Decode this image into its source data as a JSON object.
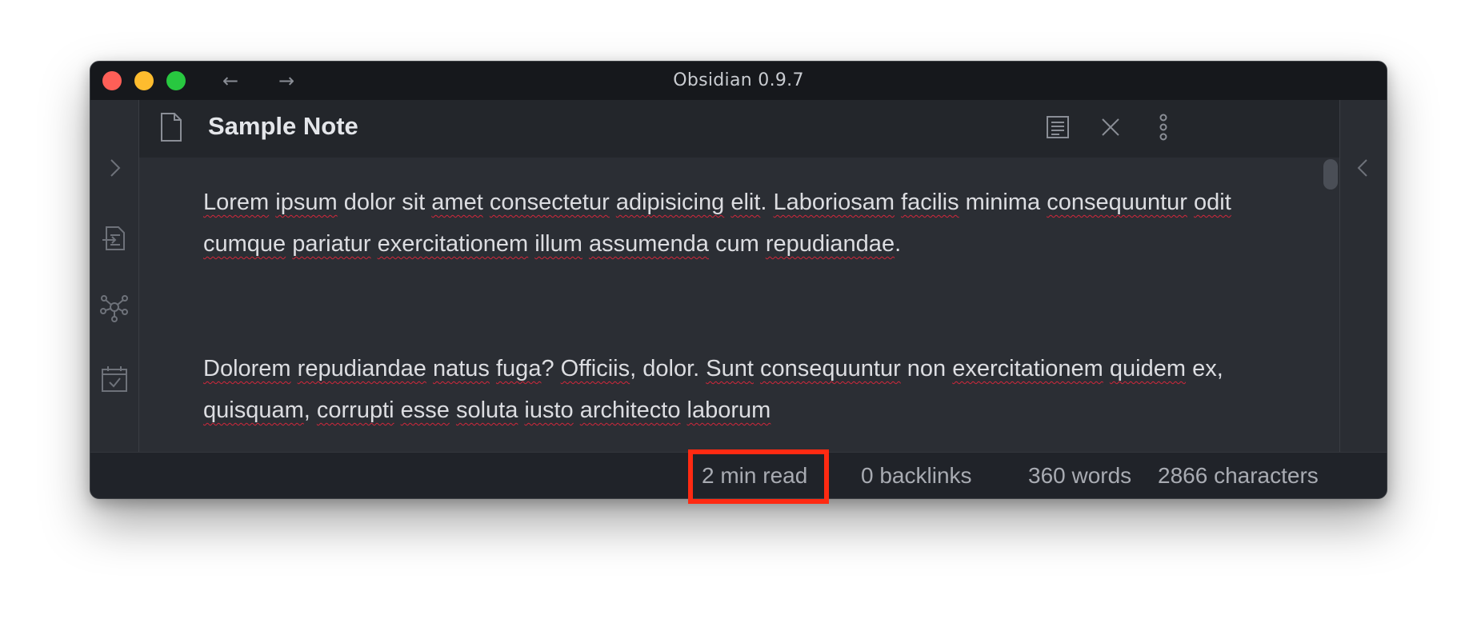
{
  "window": {
    "title": "Obsidian 0.9.7",
    "back_icon": "←",
    "forward_icon": "→"
  },
  "note": {
    "title": "Sample Note",
    "paragraphs": [
      [
        {
          "t": "Lorem",
          "err": true
        },
        {
          "t": " "
        },
        {
          "t": "ipsum",
          "err": true
        },
        {
          "t": " "
        },
        {
          "t": "dolor sit "
        },
        {
          "t": "amet",
          "err": true
        },
        {
          "t": " "
        },
        {
          "t": "consectetur",
          "err": true
        },
        {
          "t": " "
        },
        {
          "t": "adipisicing",
          "err": true
        },
        {
          "t": " "
        },
        {
          "t": "elit",
          "err": true
        },
        {
          "t": ". "
        },
        {
          "t": "Laboriosam",
          "err": true
        },
        {
          "t": " "
        },
        {
          "t": "facilis",
          "err": true
        },
        {
          "t": " minima "
        },
        {
          "t": "consequuntur",
          "err": true
        },
        {
          "t": " "
        },
        {
          "t": "odit",
          "err": true
        },
        {
          "t": " "
        },
        {
          "t": "cumque",
          "err": true
        },
        {
          "t": " "
        },
        {
          "t": "pariatur",
          "err": true
        },
        {
          "t": " "
        },
        {
          "t": "exercitationem",
          "err": true
        },
        {
          "t": " "
        },
        {
          "t": "illum",
          "err": true
        },
        {
          "t": " "
        },
        {
          "t": "assumenda",
          "err": true
        },
        {
          "t": " cum "
        },
        {
          "t": "repudiandae",
          "err": true
        },
        {
          "t": "."
        }
      ],
      [
        {
          "t": "Dolorem",
          "err": true
        },
        {
          "t": " "
        },
        {
          "t": "repudiandae",
          "err": true
        },
        {
          "t": " "
        },
        {
          "t": "natus",
          "err": true
        },
        {
          "t": " "
        },
        {
          "t": "fuga",
          "err": true
        },
        {
          "t": "? "
        },
        {
          "t": "Officiis",
          "err": true
        },
        {
          "t": ", dolor. "
        },
        {
          "t": "Sunt",
          "err": true
        },
        {
          "t": " "
        },
        {
          "t": "consequuntur",
          "err": true
        },
        {
          "t": " non "
        },
        {
          "t": "exercitationem",
          "err": true
        },
        {
          "t": " "
        },
        {
          "t": "quidem",
          "err": true
        },
        {
          "t": " ex, "
        },
        {
          "t": "quisquam",
          "err": true
        },
        {
          "t": ", "
        },
        {
          "t": "corrupti",
          "err": true
        },
        {
          "t": " "
        },
        {
          "t": "esse",
          "err": true
        },
        {
          "t": " "
        },
        {
          "t": "soluta",
          "err": true
        },
        {
          "t": " "
        },
        {
          "t": "iusto",
          "err": true
        },
        {
          "t": " "
        },
        {
          "t": "architecto",
          "err": true
        },
        {
          "t": " "
        },
        {
          "t": "laborum",
          "err": true
        }
      ]
    ]
  },
  "status": {
    "read_time": "2 min read",
    "backlinks": "0 backlinks",
    "words": "360 words",
    "characters": "2866 characters"
  },
  "colors": {
    "accent_highlight": "#ff2a12",
    "spellcheck": "#d2273b",
    "background": "#2b2e34"
  },
  "icons": {
    "left_ribbon": [
      "chevron-right-icon",
      "import-icon",
      "graph-icon",
      "calendar-check-icon"
    ],
    "header_actions": [
      "reading-view-icon",
      "close-icon",
      "more-options-icon"
    ],
    "right_ribbon": [
      "chevron-left-icon"
    ]
  }
}
